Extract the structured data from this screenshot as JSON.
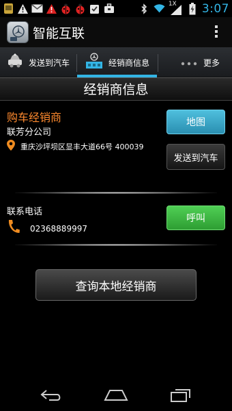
{
  "status_bar": {
    "time": "3:07",
    "network_label": "1X",
    "icons_left": [
      "app-icon",
      "warning-icon",
      "gmail-icon",
      "warning-icon",
      "ladybug-icon",
      "ladybug-icon",
      "checklist-icon",
      "briefcase-icon"
    ],
    "icons_right": [
      "bluetooth-icon",
      "wifi-icon",
      "signal-icon",
      "battery-charging-icon"
    ]
  },
  "action_bar": {
    "title": "智能互联"
  },
  "tabs": [
    {
      "label": "发送到汽车",
      "icon": "car-icon"
    },
    {
      "label": "经销商信息",
      "icon": "dealer-icon",
      "selected": true
    },
    {
      "label": "更多",
      "icon": "more-dots-icon"
    }
  ],
  "section_title": "经销商信息",
  "dealer": {
    "type_label": "购车经销商",
    "name": "联芳分公司",
    "address": "重庆沙坪坝区显丰大道66号 400039",
    "map_button": "地图",
    "send_button": "发送到汽车"
  },
  "contact": {
    "label": "联系电话",
    "phone": "02368889997",
    "call_button": "呼叫"
  },
  "query_button": "查询本地经销商",
  "colors": {
    "accent_blue": "#33b5e5",
    "dealer_orange": "#ff8a2e",
    "map_button": "#3aa8cc",
    "call_button": "#3db843"
  }
}
